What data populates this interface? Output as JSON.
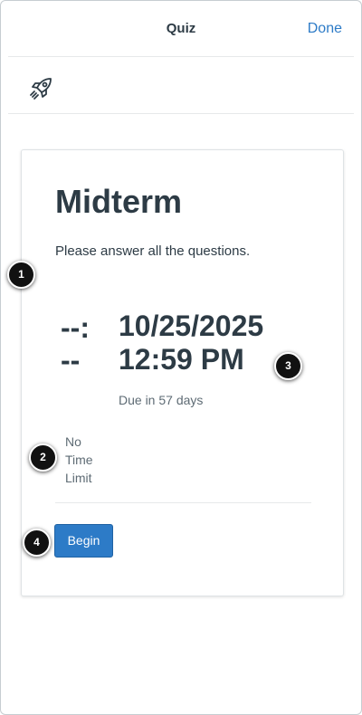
{
  "nav": {
    "title": "Quiz",
    "done_label": "Done"
  },
  "toolbar": {
    "icon": "rocket-icon"
  },
  "quiz": {
    "title": "Midterm",
    "description": "Please answer all the questions.",
    "time_limit_value": "--:--",
    "time_limit_label": "No Time Limit",
    "due_date": "10/25/2025 12:59 PM",
    "due_relative": "Due in 57 days",
    "begin_label": "Begin"
  },
  "callouts": [
    "1",
    "2",
    "3",
    "4"
  ],
  "colors": {
    "accent": "#2d7bc7",
    "text": "#2d3b45",
    "muted": "#5e6b74"
  }
}
